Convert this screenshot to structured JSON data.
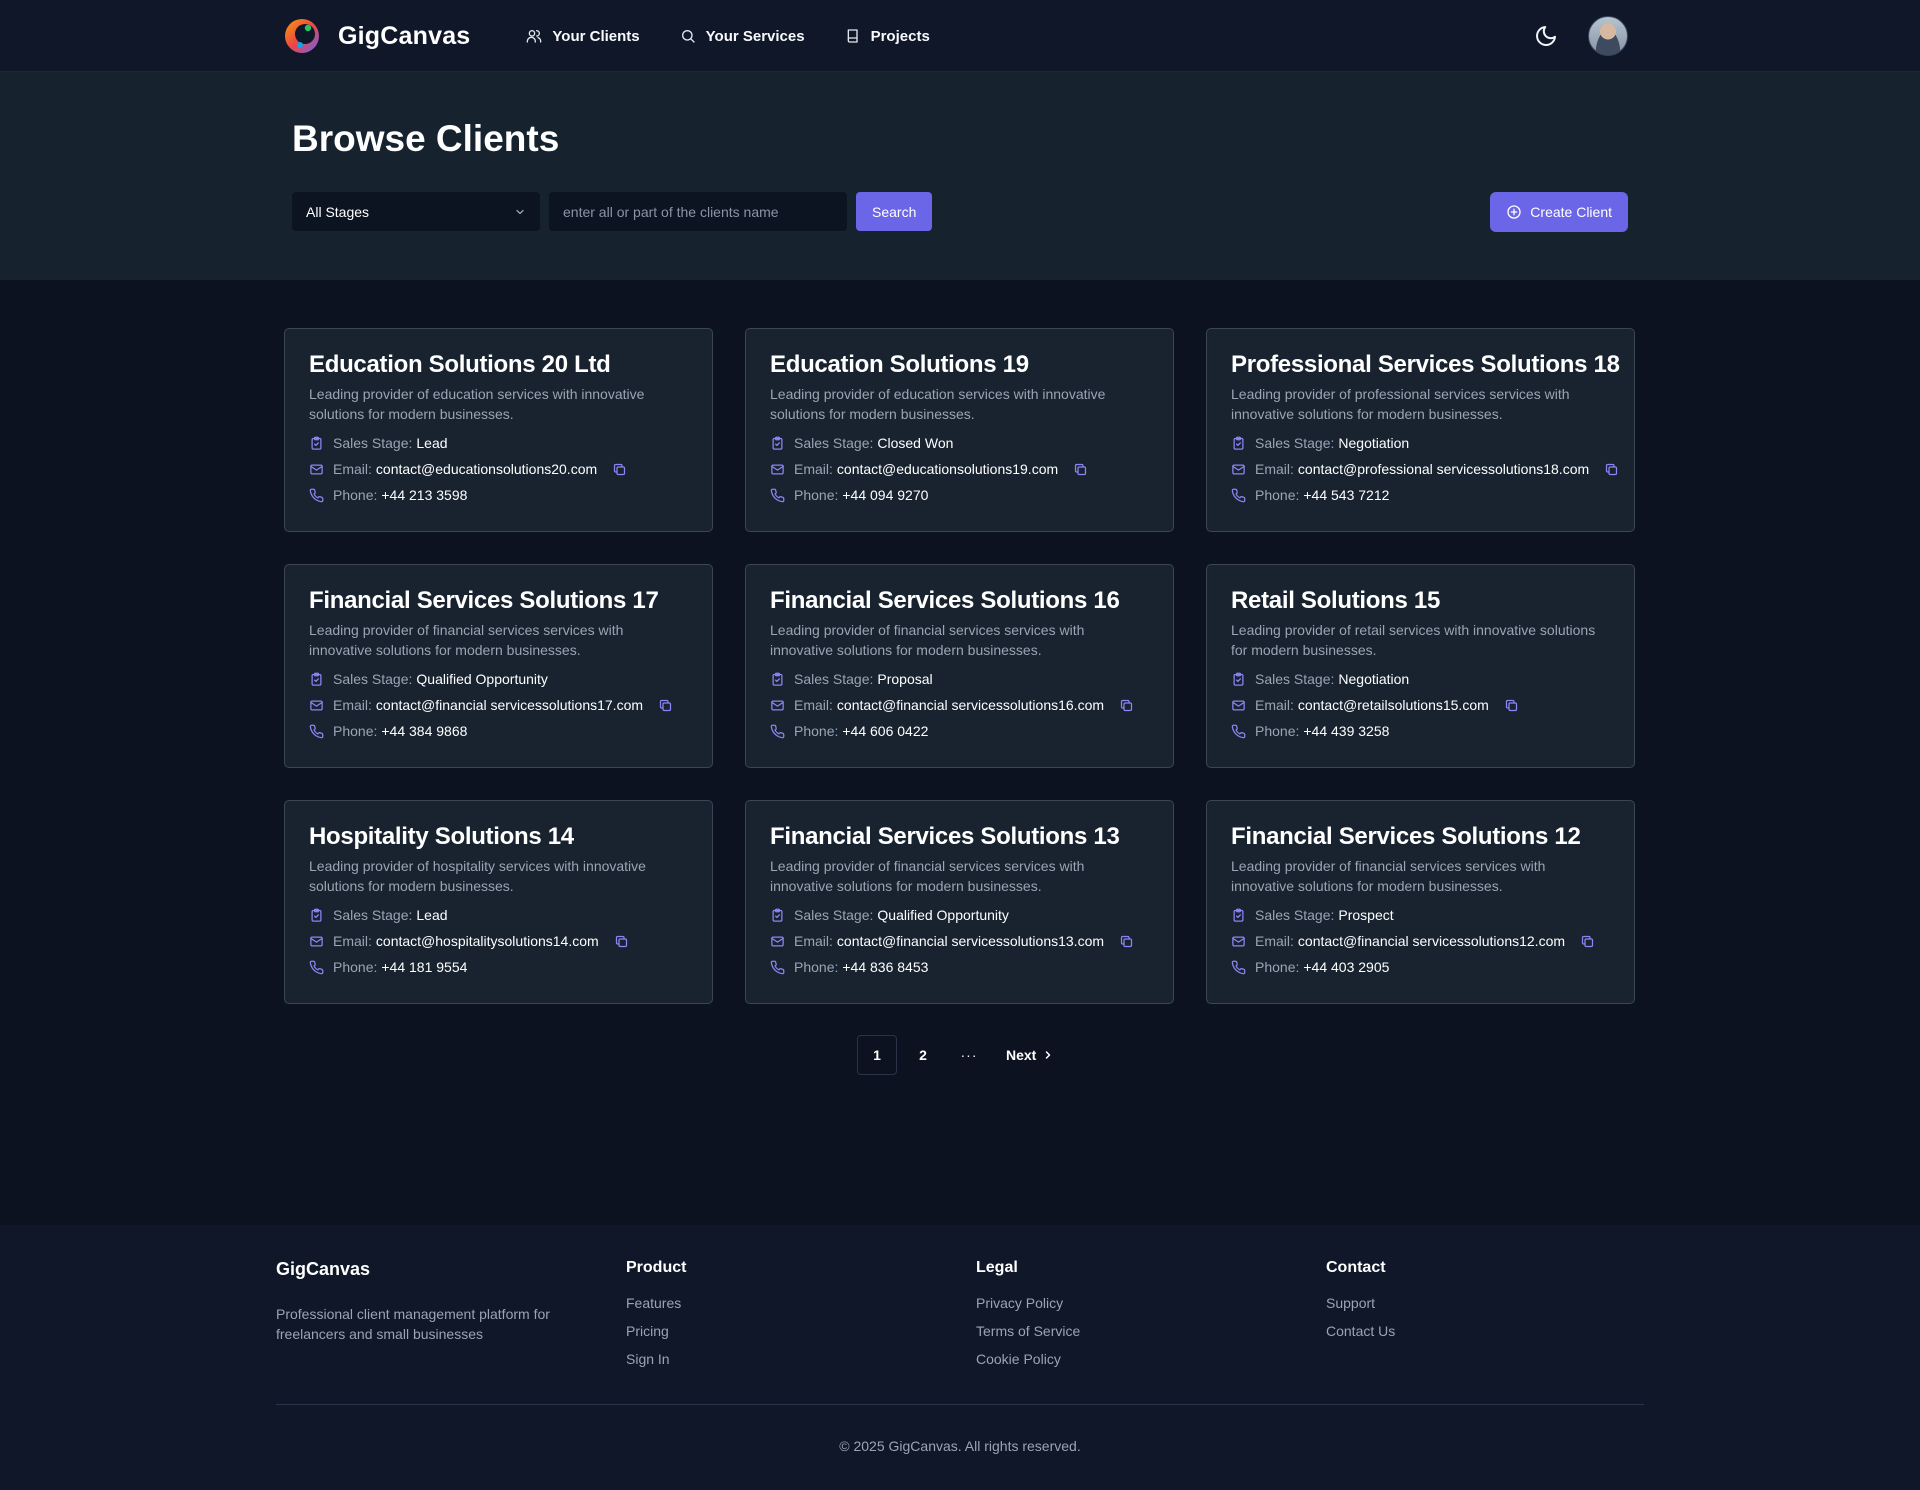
{
  "header": {
    "brand": "GigCanvas",
    "nav": [
      {
        "label": "Your Clients",
        "icon": "users-icon"
      },
      {
        "label": "Your Services",
        "icon": "search-icon"
      },
      {
        "label": "Projects",
        "icon": "book-icon"
      }
    ]
  },
  "hero": {
    "title": "Browse Clients",
    "stage_filter": "All Stages",
    "search_placeholder": "enter all or part of the clients name",
    "search_button": "Search",
    "create_button": "Create Client"
  },
  "labels": {
    "sales_stage": "Sales Stage:",
    "email": "Email:",
    "phone": "Phone:"
  },
  "clients": [
    {
      "name": "Education Solutions 20 Ltd",
      "description": "Leading provider of education services with innovative solutions for modern businesses.",
      "stage": "Lead",
      "email": "contact@educationsolutions20.com",
      "phone": "+44 213 3598"
    },
    {
      "name": "Education Solutions 19",
      "description": "Leading provider of education services with innovative solutions for modern businesses.",
      "stage": "Closed Won",
      "email": "contact@educationsolutions19.com",
      "phone": "+44 094 9270"
    },
    {
      "name": "Professional Services Solutions 18",
      "description": "Leading provider of professional services services with innovative solutions for modern businesses.",
      "stage": "Negotiation",
      "email": "contact@professional servicessolutions18.com",
      "phone": "+44 543 7212"
    },
    {
      "name": "Financial Services Solutions 17",
      "description": "Leading provider of financial services services with innovative solutions for modern businesses.",
      "stage": "Qualified Opportunity",
      "email": "contact@financial servicessolutions17.com",
      "phone": "+44 384 9868"
    },
    {
      "name": "Financial Services Solutions 16",
      "description": "Leading provider of financial services services with innovative solutions for modern businesses.",
      "stage": "Proposal",
      "email": "contact@financial servicessolutions16.com",
      "phone": "+44 606 0422"
    },
    {
      "name": "Retail Solutions 15",
      "description": "Leading provider of retail services with innovative solutions for modern businesses.",
      "stage": "Negotiation",
      "email": "contact@retailsolutions15.com",
      "phone": "+44 439 3258"
    },
    {
      "name": "Hospitality Solutions 14",
      "description": "Leading provider of hospitality services with innovative solutions for modern businesses.",
      "stage": "Lead",
      "email": "contact@hospitalitysolutions14.com",
      "phone": "+44 181 9554"
    },
    {
      "name": "Financial Services Solutions 13",
      "description": "Leading provider of financial services services with innovative solutions for modern businesses.",
      "stage": "Qualified Opportunity",
      "email": "contact@financial servicessolutions13.com",
      "phone": "+44 836 8453"
    },
    {
      "name": "Financial Services Solutions 12",
      "description": "Leading provider of financial services services with innovative solutions for modern businesses.",
      "stage": "Prospect",
      "email": "contact@financial servicessolutions12.com",
      "phone": "+44 403 2905"
    }
  ],
  "pagination": {
    "pages": [
      "1",
      "2"
    ],
    "current": "1",
    "ellipsis": "···",
    "next": "Next"
  },
  "footer": {
    "brand": "GigCanvas",
    "tagline": "Professional client management platform for freelancers and small businesses",
    "columns": [
      {
        "heading": "Product",
        "links": [
          "Features",
          "Pricing",
          "Sign In"
        ]
      },
      {
        "heading": "Legal",
        "links": [
          "Privacy Policy",
          "Terms of Service",
          "Cookie Policy"
        ]
      },
      {
        "heading": "Contact",
        "links": [
          "Support",
          "Contact Us"
        ]
      }
    ],
    "copyright": "© 2025 GigCanvas. All rights reserved."
  },
  "colors": {
    "accent": "#6b66e8",
    "icon_accent": "#8b86f5",
    "card_bg": "#18232f",
    "page_bg": "#0c1220"
  }
}
